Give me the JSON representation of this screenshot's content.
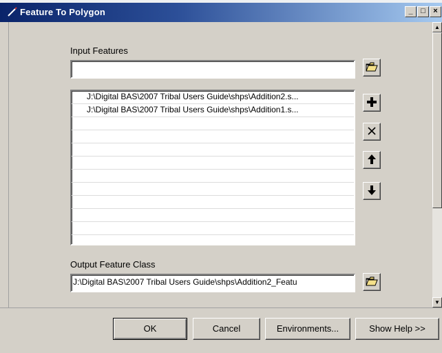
{
  "window": {
    "title": "Feature To Polygon",
    "minimize_glyph": "_",
    "maximize_glyph": "□",
    "close_glyph": "×"
  },
  "input_features": {
    "label": "Input Features",
    "value": "",
    "items": [
      "J:\\Digital BAS\\2007 Tribal Users Guide\\shps\\Addition2.s...",
      "J:\\Digital BAS\\2007 Tribal Users Guide\\shps\\Addition1.s...",
      "",
      "",
      "",
      "",
      "",
      "",
      "",
      "",
      "",
      ""
    ]
  },
  "output_feature_class": {
    "label": "Output Feature Class",
    "value": "J:\\Digital BAS\\2007 Tribal Users Guide\\shps\\Addition2_Featu"
  },
  "buttons": {
    "ok": "OK",
    "cancel": "Cancel",
    "environments": "Environments...",
    "show_help": "Show Help >>"
  },
  "icons": {
    "browse": "open-folder-icon",
    "add": "plus-icon",
    "remove": "x-icon",
    "move_up": "arrow-up-icon",
    "move_down": "arrow-down-icon"
  }
}
